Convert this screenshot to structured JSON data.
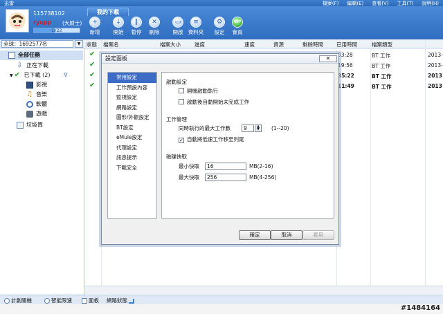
{
  "app": {
    "title_bar_app": "迅雷",
    "menu": [
      "檔案(F)",
      "編輯(E)",
      "查看(V)",
      "工具(T)",
      "說明(H)"
    ]
  },
  "user": {
    "id": "115738102",
    "name": "ryupp",
    "rank": "(大尉士)",
    "level": "LV22",
    "level_progress": 0.45
  },
  "toolbar": {
    "tab_label": "我的下載",
    "tools": [
      {
        "label": "新增",
        "icon": "add-icon"
      },
      {
        "label": "開始",
        "icon": "start-icon"
      },
      {
        "label": "暫停",
        "icon": "pause-icon"
      },
      {
        "label": "刪除",
        "icon": "delete-icon"
      },
      {
        "label": "開啟",
        "icon": "open-icon"
      },
      {
        "label": "資料夾",
        "icon": "folder-icon"
      },
      {
        "label": "設定",
        "icon": "settings-icon"
      },
      {
        "label": "會員",
        "icon": "vip-icon"
      }
    ]
  },
  "search": {
    "scope": "全球：1692577名"
  },
  "sidebar": {
    "items": [
      {
        "label": "全部任務",
        "icon": "all-tasks-icon"
      },
      {
        "label": "正在下載",
        "icon": "downloading-icon"
      },
      {
        "label": "已下載 (2)",
        "icon": "downloaded-icon"
      },
      {
        "label": "影視",
        "icon": "video-icon"
      },
      {
        "label": "音樂",
        "icon": "music-icon"
      },
      {
        "label": "軟體",
        "icon": "software-icon"
      },
      {
        "label": "遊戲",
        "icon": "game-icon"
      },
      {
        "label": "垃圾筒",
        "icon": "trash-icon"
      }
    ]
  },
  "list": {
    "columns": [
      "狀態",
      "檔案名",
      "檔案大小",
      "進度",
      "速度",
      "資源",
      "剩餘時間",
      "已用時間",
      "檔案類型"
    ],
    "rows": [
      {
        "used_time": "03:28",
        "type": "BT 工作",
        "date": "2013-"
      },
      {
        "used_time": "19:56",
        "type": "BT 工作",
        "date": "2013-"
      },
      {
        "used_time": "35:22",
        "type": "BT 工作",
        "date": "2013"
      },
      {
        "used_time": "11:49",
        "type": "BT 工作",
        "date": "2013"
      }
    ]
  },
  "statusbar": {
    "items": [
      "計劃關機",
      "智能限速",
      "面板",
      "網路狀態"
    ]
  },
  "watermark": "#1484164",
  "dialog": {
    "title": "設定面板",
    "close": "✕",
    "nav": [
      "常用設定",
      "工作預設內容",
      "監視設定",
      "網路設定",
      "圖形/外觀設定",
      "BT設定",
      "eMule設定",
      "代理設定",
      "訊息提示",
      "下載安全"
    ],
    "startup": {
      "header": "啟動設定",
      "opt1": "開機啟動執行",
      "opt2": "啟動後自動開始未完成工作"
    },
    "task": {
      "header": "工作管理",
      "max_label": "同時執行的最大工作數",
      "max_value": "9",
      "max_range": "(1--20)",
      "auto_move": "自動將低速工作移至列尾"
    },
    "cache": {
      "header": "磁碟快取",
      "min_label": "最小快取",
      "min_value": "16",
      "min_unit": "MB(2-16)",
      "max_label": "最大快取",
      "max_value": "256",
      "max_unit": "MB(4-256)"
    },
    "buttons": {
      "ok": "確定",
      "cancel": "取消",
      "apply": "套用"
    }
  }
}
